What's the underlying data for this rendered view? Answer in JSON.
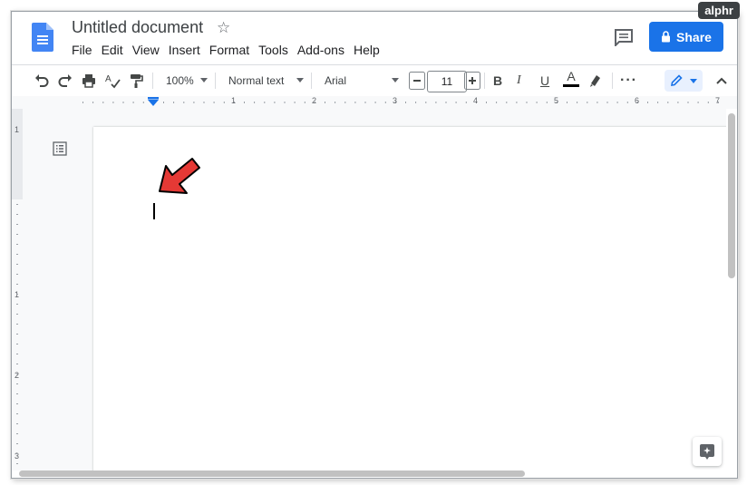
{
  "watermark": "alphr",
  "header": {
    "title": "Untitled document",
    "menu": [
      "File",
      "Edit",
      "View",
      "Insert",
      "Format",
      "Tools",
      "Add-ons",
      "Help"
    ],
    "share_label": "Share"
  },
  "toolbar": {
    "zoom": "100%",
    "style": "Normal text",
    "font": "Arial",
    "font_size": "11",
    "bold": "B",
    "italic": "I",
    "underline": "U",
    "text_color": "A"
  },
  "ruler": {
    "h_ticks": [
      "1",
      "2",
      "3",
      "4",
      "5",
      "6",
      "7"
    ],
    "v_ticks": [
      "1",
      "1",
      "2",
      "3"
    ]
  },
  "colors": {
    "accent": "#1a73e8",
    "annotation_arrow": "#e53935"
  },
  "icons": [
    "docs-logo-icon",
    "star-icon",
    "comments-icon",
    "lock-icon",
    "undo-icon",
    "redo-icon",
    "print-icon",
    "spellcheck-icon",
    "paint-format-icon",
    "minus-icon",
    "plus-icon",
    "text-color-icon",
    "highlight-icon",
    "more-icon",
    "pencil-icon",
    "chevron-up-icon",
    "outline-icon",
    "explore-icon"
  ]
}
